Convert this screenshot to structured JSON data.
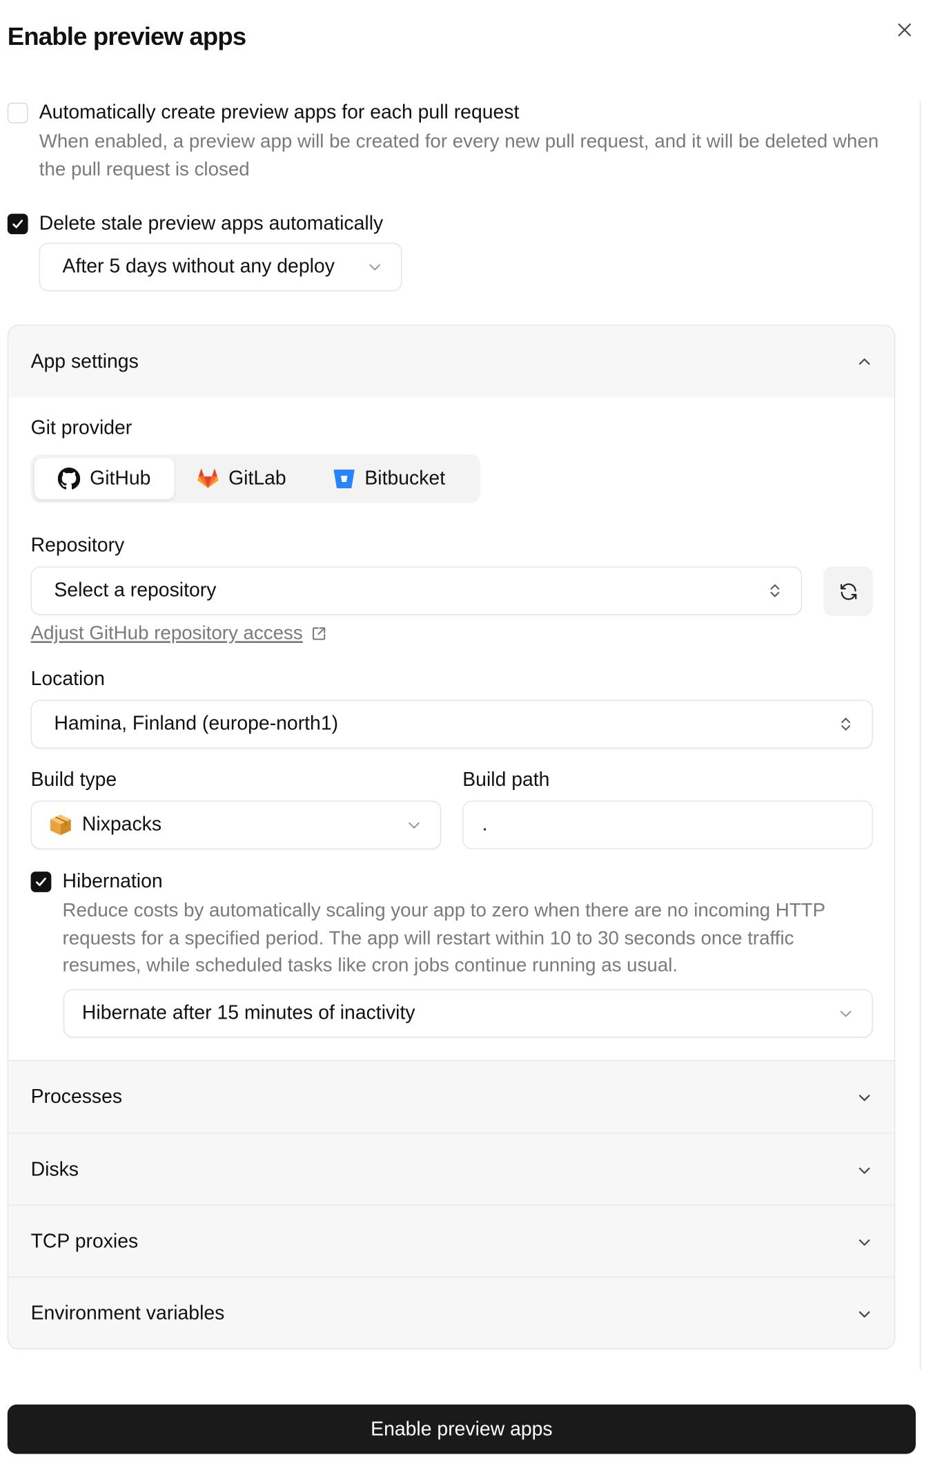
{
  "dialog": {
    "title": "Enable preview apps"
  },
  "auto_create": {
    "checked": false,
    "label": "Automatically create preview apps for each pull request",
    "description": "When enabled, a preview app will be created for every new pull request, and it will be deleted when the pull request is closed"
  },
  "delete_stale": {
    "checked": true,
    "label": "Delete stale preview apps automatically",
    "selected": "After 5 days without any deploy"
  },
  "app_settings": {
    "title": "App settings",
    "git_provider_label": "Git provider",
    "providers": [
      {
        "name": "GitHub",
        "icon": "github-icon",
        "active": true
      },
      {
        "name": "GitLab",
        "icon": "gitlab-icon",
        "active": false
      },
      {
        "name": "Bitbucket",
        "icon": "bitbucket-icon",
        "active": false
      }
    ],
    "repository_label": "Repository",
    "repository_placeholder": "Select a repository",
    "adjust_link": "Adjust GitHub repository access",
    "location_label": "Location",
    "location_value": "Hamina, Finland (europe-north1)",
    "build_type_label": "Build type",
    "build_type_value": "Nixpacks",
    "build_path_label": "Build path",
    "build_path_value": ".",
    "hibernation": {
      "checked": true,
      "label": "Hibernation",
      "description": "Reduce costs by automatically scaling your app to zero when there are no incoming HTTP requests for a specified period. The app will restart within 10 to 30 seconds once traffic resumes, while scheduled tasks like cron jobs continue running as usual.",
      "selected": "Hibernate after 15 minutes of inactivity"
    }
  },
  "sections": [
    {
      "title": "Processes"
    },
    {
      "title": "Disks"
    },
    {
      "title": "TCP proxies"
    },
    {
      "title": "Environment variables"
    }
  ],
  "submit_label": "Enable preview apps",
  "colors": {
    "primary_button": "#1a1a1a",
    "checkbox_checked": "#111111",
    "gitlab": "#e24329",
    "bitbucket": "#2684ff",
    "nixpacks_box": "#e8a33a"
  }
}
